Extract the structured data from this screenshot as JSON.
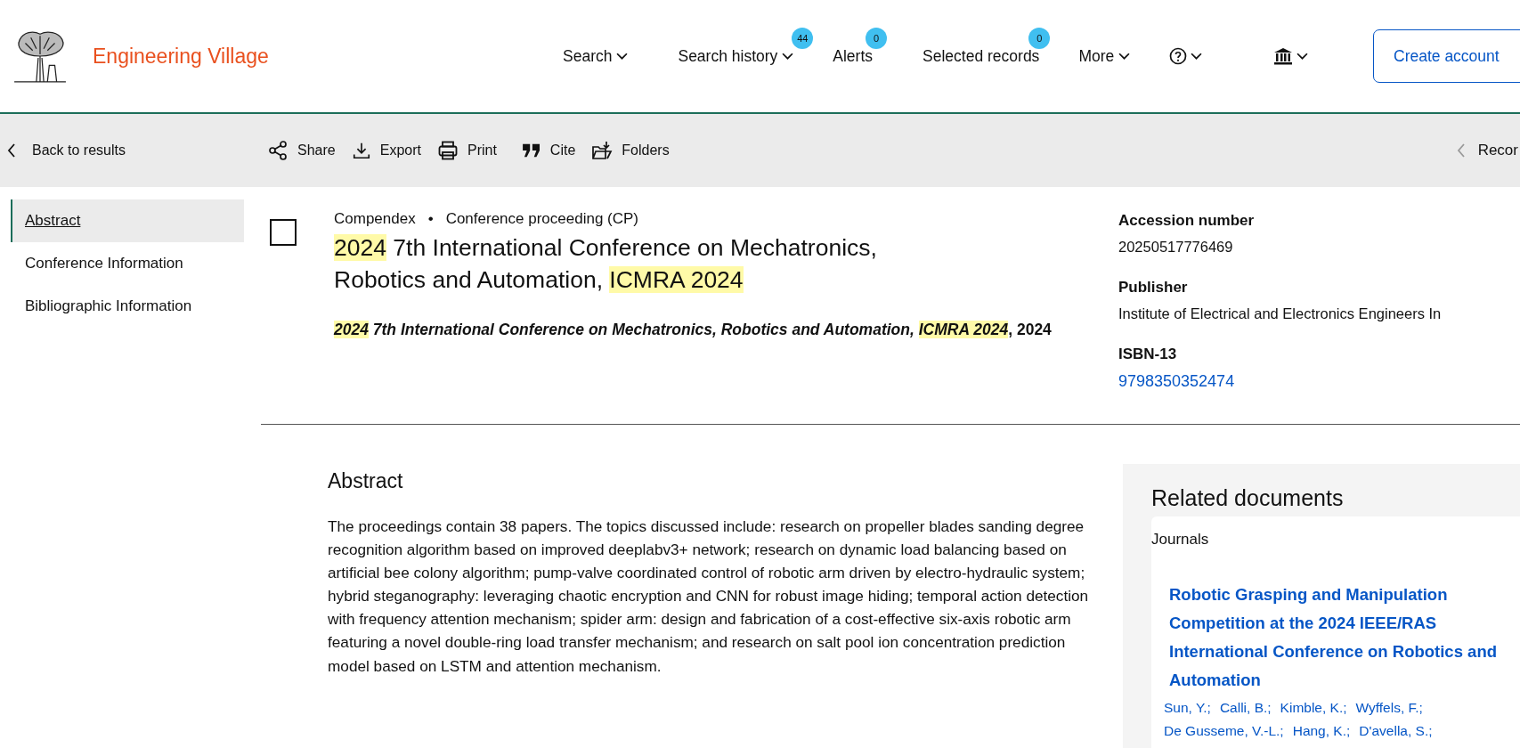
{
  "header": {
    "brand": "Engineering Village",
    "nav": [
      {
        "kind": "dropdown",
        "label": "Search"
      },
      {
        "kind": "dropdown",
        "label": "Search history",
        "badge": "44"
      },
      {
        "kind": "plain",
        "label": "Alerts",
        "badge": "0"
      },
      {
        "kind": "plain",
        "label": "Selected records",
        "badge": "0"
      },
      {
        "kind": "dropdown",
        "label": "More"
      },
      {
        "kind": "help"
      },
      {
        "kind": "institution"
      }
    ],
    "create_account": "Create account"
  },
  "toolbar": {
    "back": "Back to results",
    "actions": [
      {
        "kind": "share",
        "label": "Share"
      },
      {
        "kind": "export",
        "label": "Export"
      },
      {
        "kind": "print",
        "label": "Print"
      },
      {
        "kind": "cite",
        "label": "Cite"
      },
      {
        "kind": "folders",
        "label": "Folders"
      }
    ],
    "record_nav": "Recor"
  },
  "sidebar": {
    "items": [
      {
        "label": "Abstract",
        "selected": true
      },
      {
        "label": "Conference Information",
        "selected": false
      },
      {
        "label": "Bibliographic Information",
        "selected": false
      }
    ]
  },
  "record": {
    "checked": false,
    "database": "Compendex",
    "separator": "•",
    "doc_type": "Conference proceeding (CP)",
    "title": [
      {
        "text": "2024",
        "highlight": true
      },
      {
        "text": " 7th International Conference on Mechatronics, Robotics and Automation, ",
        "highlight": false
      },
      {
        "text": "ICMRA 2024",
        "highlight": true
      }
    ],
    "citation": [
      {
        "text": "2024",
        "highlight": true,
        "italic": true
      },
      {
        "text": " 7th International Conference on Mechatronics, Robotics and Automation, ",
        "highlight": false,
        "italic": true
      },
      {
        "text": "ICMRA 2024",
        "highlight": true,
        "italic": true
      },
      {
        "text": ", 2024",
        "highlight": false,
        "italic": false
      }
    ]
  },
  "details": [
    {
      "label": "Accession number",
      "value": "20250517776469",
      "kind": "text"
    },
    {
      "label": "Publisher",
      "value": "Institute of Electrical and Electronics Engineers In",
      "kind": "text"
    },
    {
      "label": "ISBN-13",
      "value": "9798350352474",
      "kind": "link"
    }
  ],
  "abstract": {
    "heading": "Abstract",
    "text": "The proceedings contain 38 papers. The topics discussed include: research on propeller blades sanding degree recognition algorithm based on improved deeplabv3+ network; research on dynamic load balancing based on artificial bee colony algorithm; pump-valve coordinated control of robotic arm driven by electro-hydraulic system; hybrid steganography: leveraging chaotic encryption and CNN for robust image hiding; temporal action detection with frequency attention mechanism; spider arm: design and fabrication of a cost-effective six-axis robotic arm featuring a novel double-ring load transfer mechanism; and research on salt pool ion concentration prediction model based on LSTM and attention mechanism."
  },
  "related": {
    "heading": "Related documents",
    "section": "Journals",
    "items": [
      {
        "title": "Robotic Grasping and Manipulation Competition at the 2024 IEEE/RAS International Conference on Robotics and Automation",
        "authors": [
          "Sun, Y.;",
          "Calli, B.;",
          "Kimble, K.;",
          "Wyffels, F.;",
          "De Gusseme, V.-L.;",
          "Hang, K.;",
          "D'avella, S.;"
        ]
      }
    ]
  }
}
